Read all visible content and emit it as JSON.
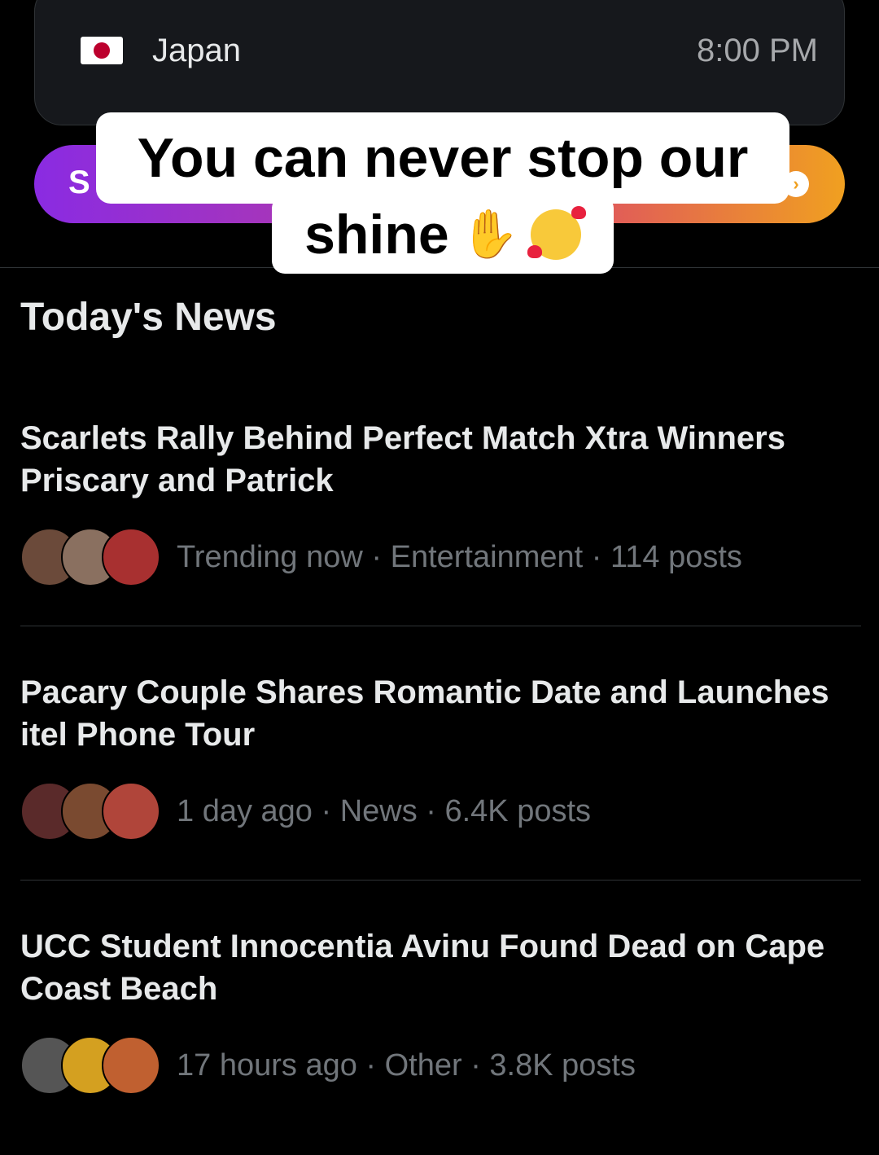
{
  "time_card": {
    "country": "Japan",
    "time": "8:00 PM",
    "flag_icon": "japan-flag-icon"
  },
  "gradient_button": {
    "lead_text": "S",
    "arrow_icon": "arrow-right-icon",
    "colors": [
      "#8a2be2",
      "#e05a5a",
      "#f0a020"
    ]
  },
  "caption": {
    "line1": "You can never stop our",
    "line2": "shine",
    "emojis": [
      "pinching-hand-emoji",
      "smiling-face-with-hearts-emoji"
    ]
  },
  "section": {
    "title": "Today's News"
  },
  "news": [
    {
      "title": "Scarlets Rally Behind Perfect Match Xtra Winners Priscary and Patrick",
      "meta": "Trending now · Entertainment · 114 posts",
      "avatar_colors": [
        "#6b4a3a",
        "#8a7060",
        "#a83030"
      ]
    },
    {
      "title": "Pacary Couple Shares Romantic Date and Launches itel Phone Tour",
      "meta": "1 day ago · News · 6.4K posts",
      "avatar_colors": [
        "#5a2a2a",
        "#7a4a30",
        "#b0453a"
      ]
    },
    {
      "title": "UCC Student Innocentia Avinu Found Dead on Cape Coast Beach",
      "meta": "17 hours ago · Other · 3.8K posts",
      "avatar_colors": [
        "#555555",
        "#d4a020",
        "#c06030"
      ]
    }
  ]
}
